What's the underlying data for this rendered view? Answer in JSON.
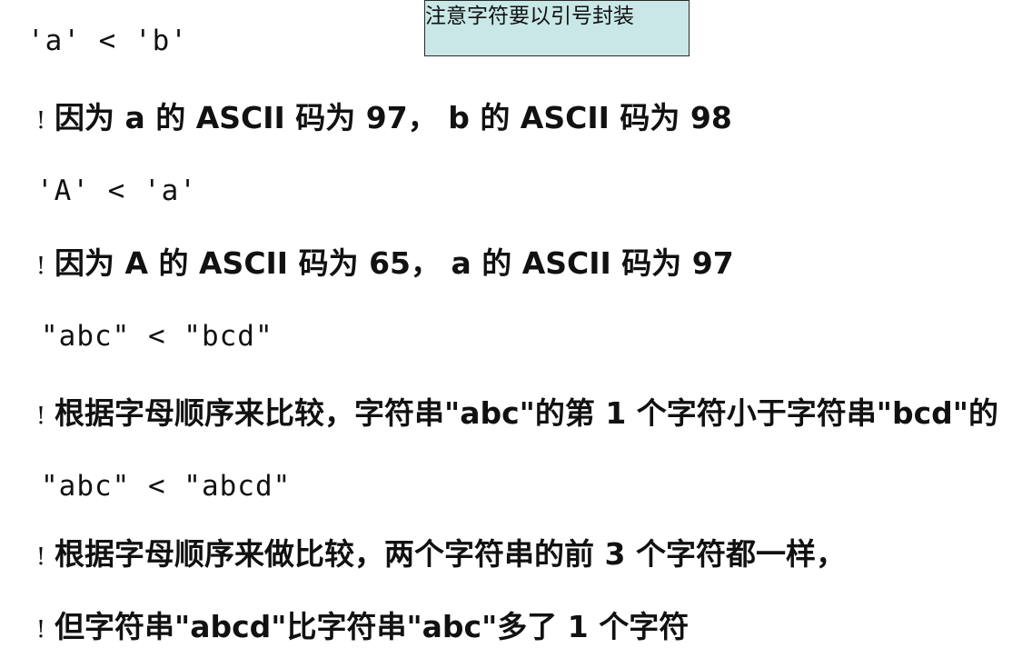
{
  "note": "注意字符要以引号封装",
  "lines": [
    {
      "kind": "code",
      "text": "'a' < 'b'"
    },
    {
      "kind": "comment",
      "marker": "!",
      "text": "因为 a 的 ASCII 码为 97， b 的 ASCII 码为 98"
    },
    {
      "kind": "code",
      "text": "'A' < 'a'"
    },
    {
      "kind": "comment",
      "marker": "!",
      "text": "因为 A 的 ASCII 码为 65， a 的 ASCII 码为 97"
    },
    {
      "kind": "code",
      "text": "\"abc\" < \"bcd\""
    },
    {
      "kind": "comment",
      "marker": "!",
      "text": "根据字母顺序来比较，字符串\"abc\"的第 1 个字符小于字符串\"bcd\"的"
    },
    {
      "kind": "code",
      "text": "\"abc\" < \"abcd\""
    },
    {
      "kind": "comment",
      "marker": "!",
      "text": "根据字母顺序来做比较，两个字符串的前 3 个字符都一样，"
    },
    {
      "kind": "comment",
      "marker": "!",
      "text": "但字符串\"abcd\"比字符串\"abc\"多了 1 个字符"
    }
  ]
}
